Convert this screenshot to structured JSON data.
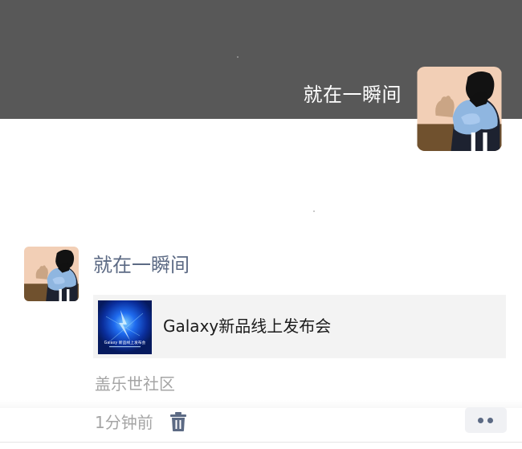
{
  "profile": {
    "name": "就在一瞬间",
    "avatar_icon": "girl-illustration-avatar",
    "cover_color": "#585858"
  },
  "post": {
    "author": "就在一瞬间",
    "link_card": {
      "title": "Galaxy新品线上发布会",
      "thumbnail_icon": "galaxy-launch-poster-thumbnail",
      "thumbnail_text": "Galaxy 新品线上发布会"
    },
    "source": "盖乐世社区",
    "time": "1分钟前",
    "delete_icon": "trash-icon",
    "more_icon": "more-dots-icon",
    "link_color": "#5c6a84"
  }
}
